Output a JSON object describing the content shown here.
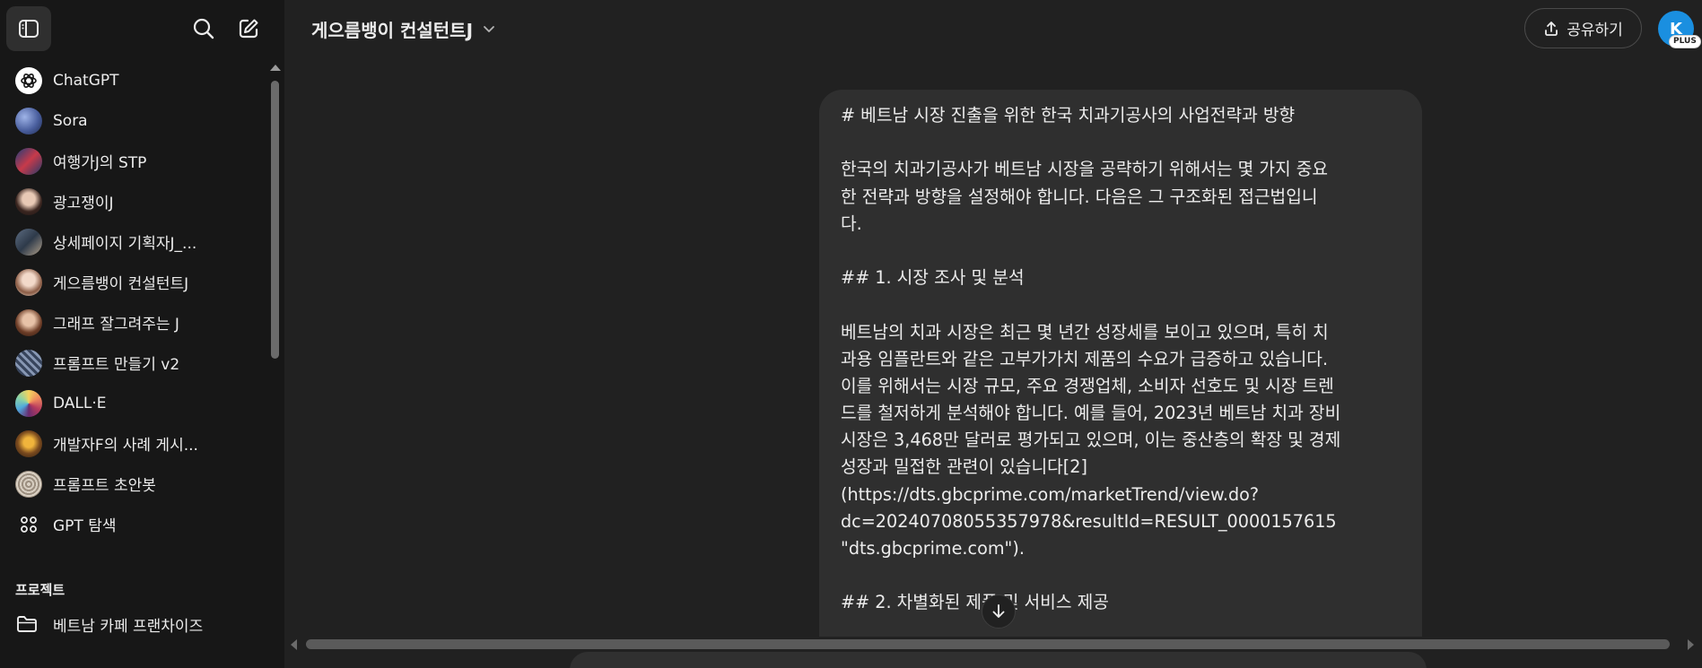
{
  "sidebar": {
    "items": [
      {
        "label": "ChatGPT",
        "icon": "chatgpt-logo-icon"
      },
      {
        "label": "Sora",
        "icon": "sora-avatar-icon"
      },
      {
        "label": "여행가J의 STP",
        "icon": "gpt-avatar-icon"
      },
      {
        "label": "광고쟁이J",
        "icon": "gpt-avatar-icon"
      },
      {
        "label": "상세페이지 기획자J_...",
        "icon": "gpt-avatar-icon"
      },
      {
        "label": "게으름뱅이 컨설턴트J",
        "icon": "gpt-avatar-icon"
      },
      {
        "label": "그래프 잘그려주는 J",
        "icon": "gpt-avatar-icon"
      },
      {
        "label": "프롬프트 만들기 v2",
        "icon": "gpt-avatar-icon"
      },
      {
        "label": "DALL·E",
        "icon": "dalle-avatar-icon"
      },
      {
        "label": "개발자F의 사례 게시...",
        "icon": "gpt-avatar-icon"
      },
      {
        "label": "프롬프트 초안봇",
        "icon": "gpt-avatar-icon"
      },
      {
        "label": "GPT 탐색",
        "icon": "grid-icon"
      }
    ],
    "projects_title": "프로젝트",
    "projects": [
      {
        "label": "베트남 카페 프랜차이즈",
        "icon": "folder-icon"
      }
    ]
  },
  "header": {
    "title": "게으름뱅이 컨설턴트J",
    "share_label": "공유하기",
    "user_initial": "K",
    "plan_badge": "PLUS"
  },
  "message": {
    "lines": [
      "# 베트남 시장 진출을 위한 한국 치과기공사의 사업전략과 방향",
      "",
      "한국의 치과기공사가 베트남 시장을 공략하기 위해서는 몇 가지 중요",
      "한 전략과 방향을 설정해야 합니다. 다음은 그 구조화된 접근법입니",
      "다.",
      "",
      "## 1. 시장 조사 및 분석",
      "",
      "베트남의 치과 시장은 최근 몇 년간 성장세를 보이고 있으며, 특히 치",
      "과용 임플란트와 같은 고부가가치 제품의 수요가 급증하고 있습니다.",
      "이를 위해서는 시장 규모, 주요 경쟁업체, 소비자 선호도 및 시장 트렌",
      "드를 철저하게 분석해야 합니다. 예를 들어, 2023년 베트남 치과 장비",
      "시장은 3,468만 달러로 평가되고 있으며, 이는 중산층의 확장 및 경제",
      "성장과 밀접한 관련이 있습니다[2]",
      "(https://dts.gbcprime.com/marketTrend/view.do?",
      "dc=20240708055357978&resultId=RESULT_0000157615",
      "\"dts.gbcprime.com\").",
      "",
      "## 2. 차별화된 제품 및 서비스 제공"
    ]
  },
  "colors": {
    "background": "#212121",
    "sidebar": "#171717",
    "bubble": "#2f2f2f",
    "avatar": "#1a8fe0"
  }
}
